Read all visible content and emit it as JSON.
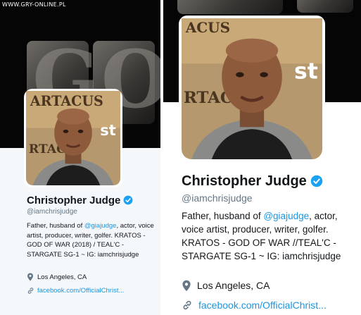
{
  "watermark": "WWW.GRY-ONLINE.PL",
  "colors": {
    "link": "#1b95e0",
    "verified": "#1da1f2",
    "muted": "#657786",
    "banner": "#050505"
  },
  "icons": {
    "verified": "verified-badge-icon",
    "location": "location-pin-icon",
    "link": "link-chain-icon"
  },
  "profiles": {
    "old": {
      "banner_text": "GO",
      "avatar_poster_text": "ARTACUS",
      "avatar_poster_text2": "RTACS",
      "name": "Christopher Judge",
      "handle": "@iamchrisjudge",
      "bio_before": "Father, husband of ",
      "bio_mention": "@giajudge",
      "bio_after": ", actor, voice artist, producer, writer, golfer. KRATOS - GOD OF WAR (2018) / TEAL'C - STARGATE SG-1 ~ IG: iamchrisjudge",
      "location": "Los Angeles, CA",
      "website": "facebook.com/OfficialChrist..."
    },
    "new": {
      "banner_text": "",
      "avatar_poster_text": "ACUS",
      "avatar_poster_text2": "RTACS",
      "name": "Christopher Judge",
      "handle": "@iamchrisjudge",
      "bio_before": "Father, husband of ",
      "bio_mention": "@giajudge",
      "bio_after": ", actor, voice artist, producer, writer, golfer. KRATOS - GOD OF WAR //TEAL'C - STARGATE SG-1 ~ IG: iamchrisjudge",
      "location": "Los Angeles, CA",
      "website": "facebook.com/OfficialChrist..."
    }
  }
}
